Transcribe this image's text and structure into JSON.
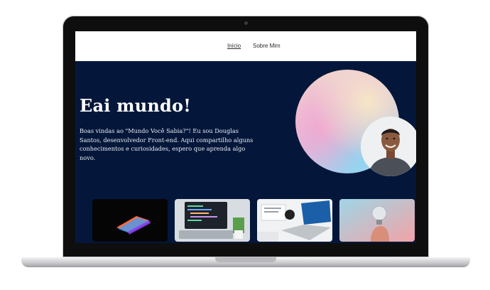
{
  "nav": {
    "items": [
      {
        "label": "Início",
        "active": true
      },
      {
        "label": "Sobre Mim",
        "active": false
      }
    ]
  },
  "hero": {
    "title": "Eai mundo!",
    "text": "Boas vindas ao \"Mundo Você Sabia?\"! Eu sou Douglas Santos, desenvolvedor Front-end. Aqui compartilho alguns conhecimentos e curiosidades, espero que aprenda algo novo."
  },
  "colors": {
    "hero_background": "#04173a",
    "navbar_background": "#ffffff"
  }
}
